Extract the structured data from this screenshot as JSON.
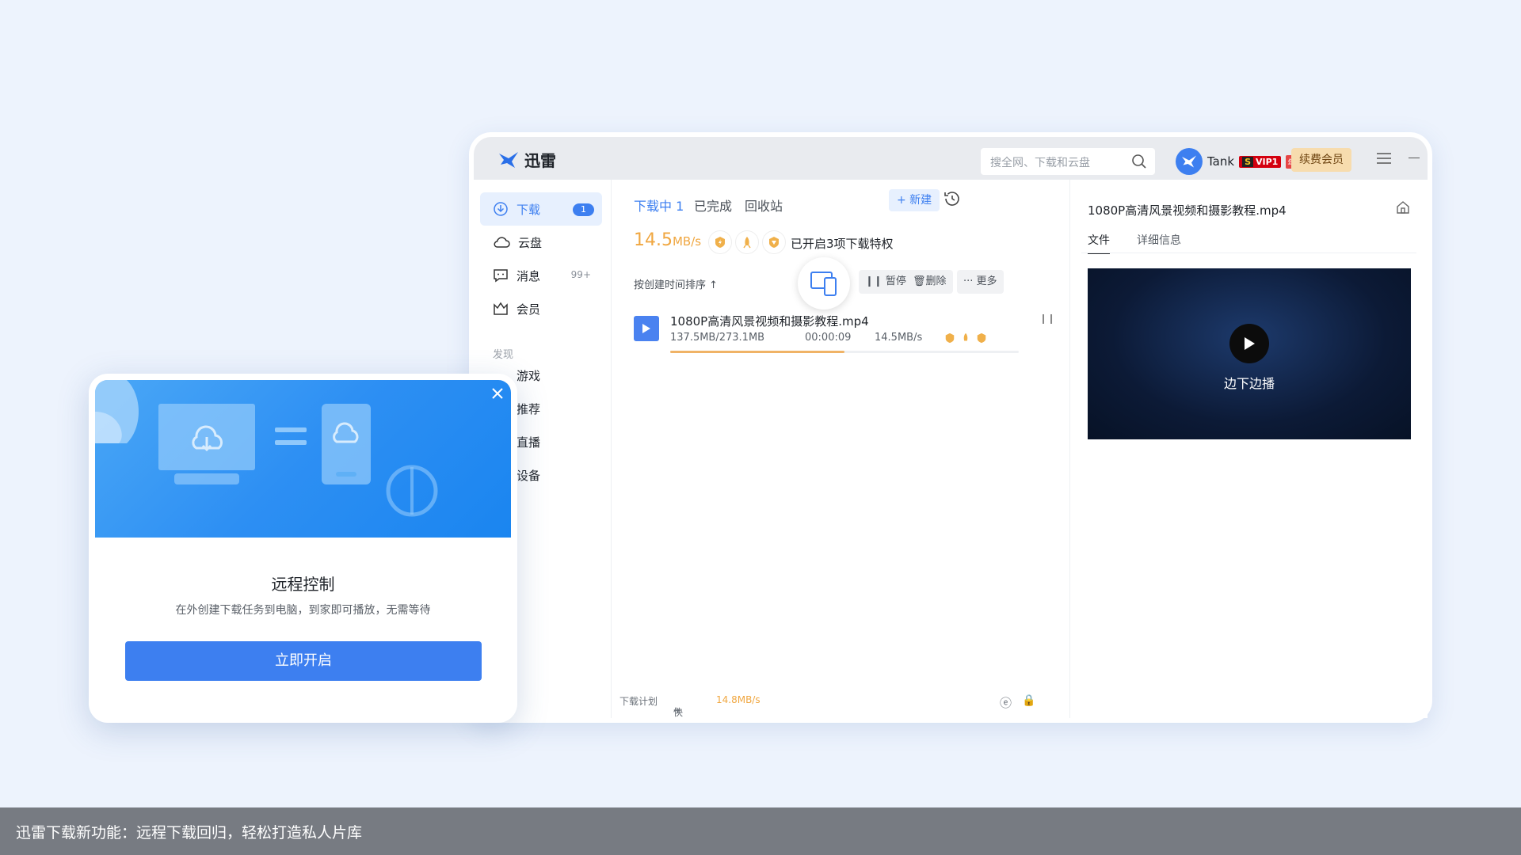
{
  "app": {
    "name": "迅雷",
    "search_placeholder": "搜全网、下载和云盘",
    "username": "Tank",
    "vip_badge": "VIP1",
    "vip_year": "年",
    "renew_label": "续费会员"
  },
  "sidebar": {
    "items": [
      {
        "label": "下载",
        "badge": "1",
        "icon": "download-icon"
      },
      {
        "label": "云盘",
        "icon": "cloud-icon"
      },
      {
        "label": "消息",
        "count": "99+",
        "icon": "message-icon"
      },
      {
        "label": "会员",
        "icon": "crown-icon"
      }
    ],
    "section_label": "发现",
    "discover": [
      {
        "label": "游戏"
      },
      {
        "label": "推荐"
      },
      {
        "label": "直播"
      },
      {
        "label": "设备"
      }
    ]
  },
  "main": {
    "tabs": [
      "下载中 1",
      "已完成",
      "回收站"
    ],
    "new_label": "+ 新建",
    "speed_value": "14.5",
    "speed_unit": "MB/s",
    "perks_text": "已开启3项下载特权",
    "sort_label": "按创建时间排序 ↑",
    "pause_label": "❙❙ 暂停",
    "delete_label": "删除",
    "more_label": "··· 更多",
    "task": {
      "name": "1080P高清风景视频和摄影教程.mp4",
      "size": "137.5MB/273.1MB",
      "time": "00:00:09",
      "speed": "14.5MB/s",
      "progress": 0.5
    },
    "footer": {
      "plan": "下载计划",
      "bird": "快鸟",
      "speed": "14.8MB/s"
    }
  },
  "detail": {
    "title": "1080P高清风景视频和摄影教程.mp4",
    "tabs": [
      "文件",
      "详细信息"
    ],
    "video_label": "边下边播"
  },
  "popup": {
    "title": "远程控制",
    "description": "在外创建下载任务到电脑，到家即可播放，无需等待",
    "button": "立即开启"
  },
  "caption": "迅雷下载新功能：远程下载回归，轻松打造私人片库",
  "colors": {
    "accent": "#3d7ff0",
    "speed": "#f0a741",
    "progress": "#f0b366"
  }
}
